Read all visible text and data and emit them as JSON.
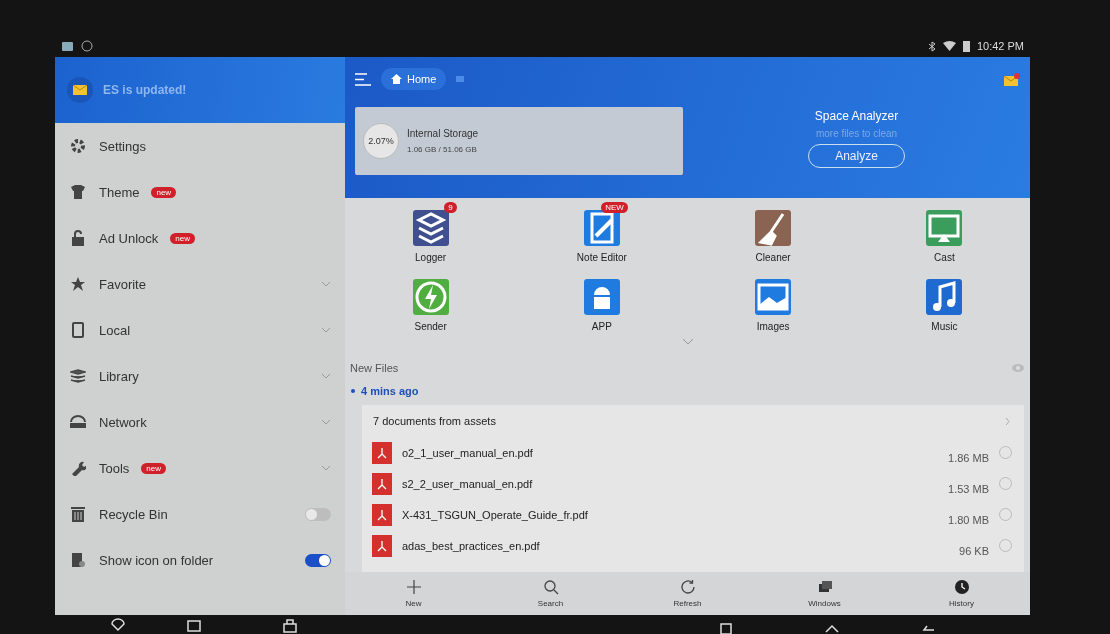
{
  "status_bar": {
    "time": "10:42 PM"
  },
  "drawer": {
    "banner": "ES is updated!",
    "items": [
      {
        "label": "Settings",
        "kind": "link"
      },
      {
        "label": "Theme",
        "kind": "link",
        "badge": "new"
      },
      {
        "label": "Ad Unlock",
        "kind": "link",
        "badge": "new"
      },
      {
        "label": "Favorite",
        "kind": "expand",
        "expanded": false
      },
      {
        "label": "Local",
        "kind": "expand",
        "expanded": false
      },
      {
        "label": "Library",
        "kind": "expand",
        "expanded": false
      },
      {
        "label": "Network",
        "kind": "expand",
        "expanded": false
      },
      {
        "label": "Tools",
        "kind": "expand",
        "expanded": false,
        "badge": "new"
      },
      {
        "label": "Recycle Bin",
        "kind": "toggle",
        "on": false
      },
      {
        "label": "Show icon on folder",
        "kind": "toggle",
        "on": true
      }
    ]
  },
  "header": {
    "breadcrumb": "Home",
    "storage": {
      "name": "Internal Storage",
      "percent": "2.07%",
      "usage": "1.06 GB / 51.06 GB"
    },
    "analyzer": {
      "title": "Space Analyzer",
      "subtitle": "more files to clean",
      "button": "Analyze"
    }
  },
  "tools": [
    {
      "label": "Logger",
      "badge": "9"
    },
    {
      "label": "Note Editor",
      "badge": "NEW"
    },
    {
      "label": "Cleaner"
    },
    {
      "label": "Cast"
    },
    {
      "label": "Sender"
    },
    {
      "label": "APP"
    },
    {
      "label": "Images"
    },
    {
      "label": "Music"
    }
  ],
  "new_files": {
    "heading": "New Files",
    "time": "4 mins ago",
    "card_title": "7 documents from assets",
    "files": [
      {
        "name": "o2_1_user_manual_en.pdf",
        "size": "1.86 MB",
        "selected": false
      },
      {
        "name": "s2_2_user_manual_en.pdf",
        "size": "1.53 MB",
        "selected": false
      },
      {
        "name": "X-431_TSGUN_Operate_Guide_fr.pdf",
        "size": "1.80 MB",
        "selected": false
      },
      {
        "name": "adas_best_practices_en.pdf",
        "size": "96 KB",
        "selected": false
      }
    ]
  },
  "bottom_bar": [
    {
      "label": "New"
    },
    {
      "label": "Search"
    },
    {
      "label": "Refresh"
    },
    {
      "label": "Windows"
    },
    {
      "label": "History"
    }
  ]
}
